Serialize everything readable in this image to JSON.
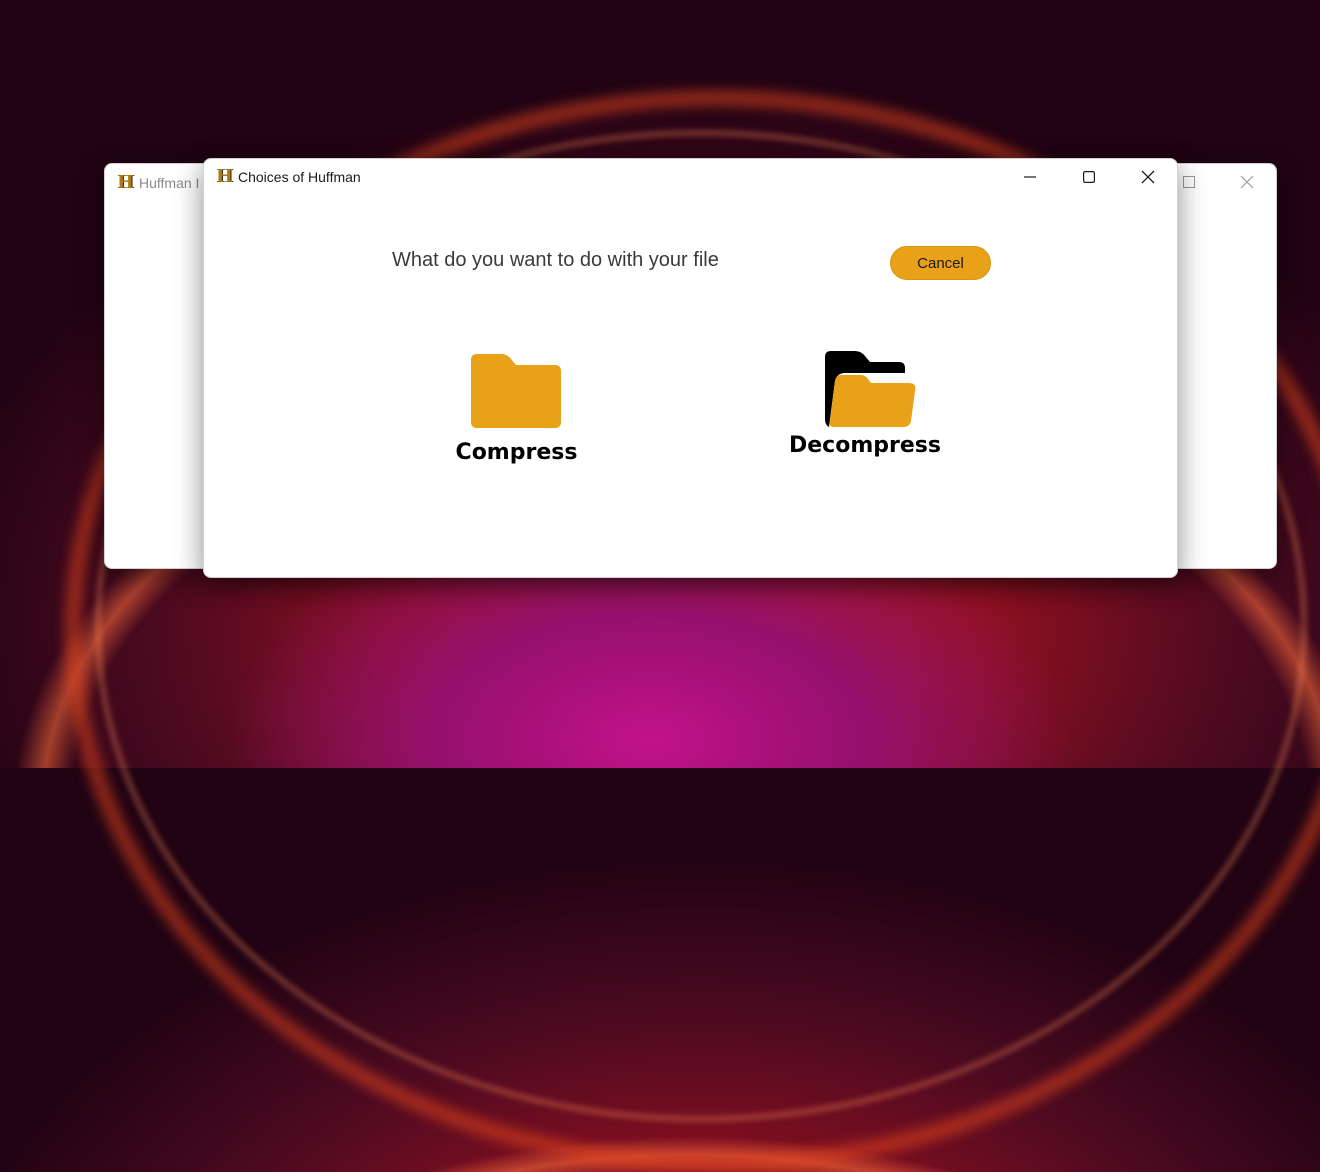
{
  "desktop": {
    "wallpaper": "red-magenta abstract"
  },
  "back_window": {
    "title": "Huffman I",
    "logo_letter": "H"
  },
  "dialog": {
    "title": "Choices of Huffman",
    "logo_letter": "H",
    "controls": [
      "minimize",
      "maximize",
      "close"
    ],
    "prompt": "What do you want to do with your file",
    "cancel_label": "Cancel",
    "options": [
      {
        "label": "Compress",
        "icon": "folder-icon"
      },
      {
        "label": "Decompress",
        "icon": "open-folder-icon"
      }
    ]
  },
  "colors": {
    "accent": "#e9a117",
    "folder": "#e9a117",
    "text": "#3a3a3a"
  }
}
